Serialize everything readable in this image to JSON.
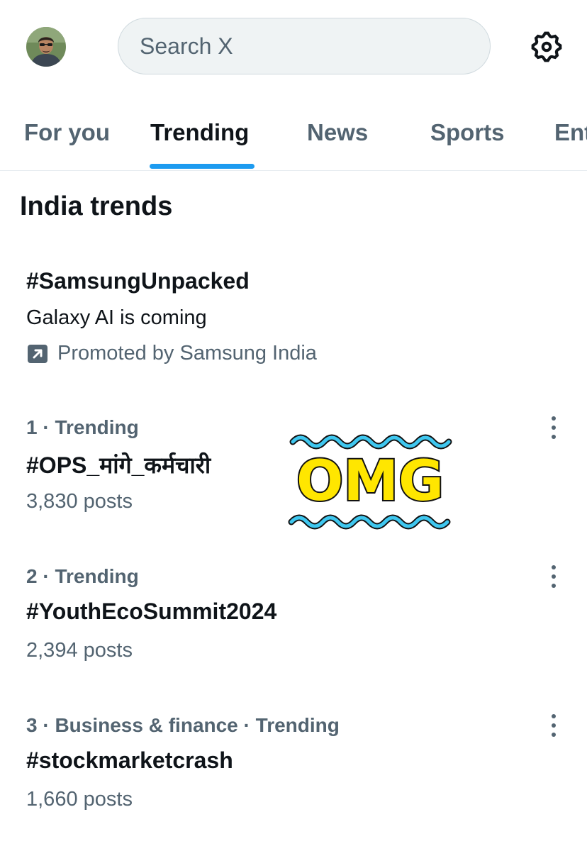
{
  "header": {
    "avatar_alt": "Profile",
    "search_placeholder": "Search X",
    "settings_icon": "gear-icon"
  },
  "tabs": [
    {
      "label": "For you",
      "active": false
    },
    {
      "label": "Trending",
      "active": true
    },
    {
      "label": "News",
      "active": false
    },
    {
      "label": "Sports",
      "active": false
    },
    {
      "label": "Entertainment",
      "active": false
    }
  ],
  "section_title": "India trends",
  "promoted": {
    "tag": "#SamsungUnpacked",
    "description": "Galaxy AI is coming",
    "promoted_by": "Promoted by Samsung India",
    "icon": "promoted-arrow-icon"
  },
  "trends": [
    {
      "meta": "1 · Trending",
      "name": "#OPS_मांगे_कर्मचारी",
      "count": "3,830 posts"
    },
    {
      "meta": "2 · Trending",
      "name": "#YouthEcoSummit2024",
      "count": "2,394 posts"
    },
    {
      "meta": "3 · Business & finance · Trending",
      "name": "#stockmarketcrash",
      "count": "1,660 posts"
    }
  ],
  "sticker": {
    "text": "OMG"
  },
  "colors": {
    "accent": "#1d9bf0",
    "text_primary": "#0f1419",
    "text_secondary": "#536471",
    "sticker_fill": "#ffe600",
    "sticker_waves": "#3fc7ef"
  }
}
